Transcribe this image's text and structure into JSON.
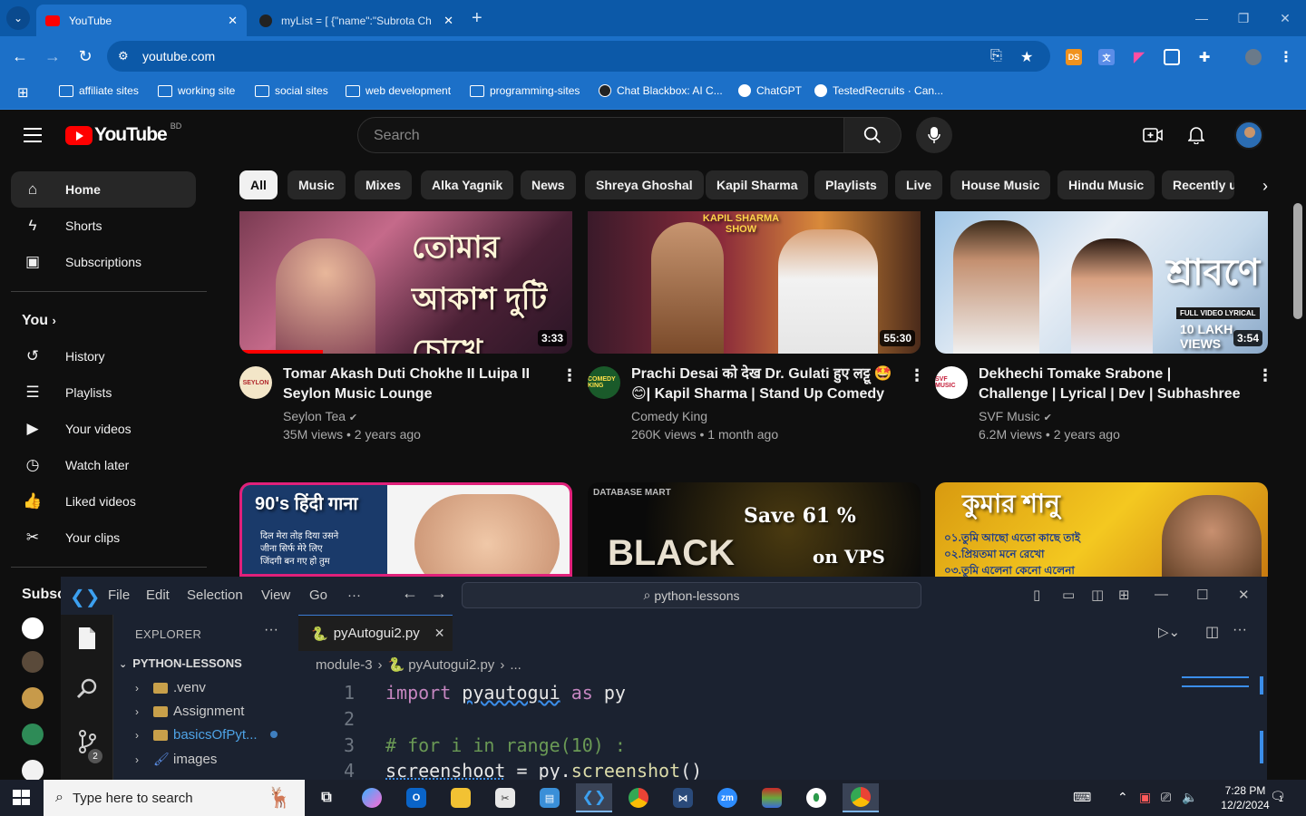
{
  "browser": {
    "tabs": [
      {
        "title": "YouTube",
        "active": true
      },
      {
        "title": "myList = [ {\"name\":\"Subrota Ch",
        "active": false
      }
    ],
    "url": "youtube.com",
    "bookmarks": [
      "affiliate sites",
      "working site",
      "social sites",
      "web development",
      "programming-sites",
      "Chat Blackbox: AI C...",
      "ChatGPT",
      "TestedRecruits · Can..."
    ],
    "ext_ds": "DS"
  },
  "youtube": {
    "logo_text": "YouTube",
    "country_code": "BD",
    "search_placeholder": "Search",
    "sidebar": {
      "main": [
        "Home",
        "Shorts",
        "Subscriptions"
      ],
      "you_heading": "You",
      "you_items": [
        "History",
        "Playlists",
        "Your videos",
        "Watch later",
        "Liked videos",
        "Your clips"
      ],
      "subscriptions_heading": "Subsc"
    },
    "chips": [
      "All",
      "Music",
      "Mixes",
      "Alka Yagnik",
      "News",
      "Shreya Ghoshal",
      "Kapil Sharma",
      "Playlists",
      "Live",
      "House Music",
      "Hindu Music",
      "Recently u"
    ],
    "videos": [
      {
        "title": "Tomar Akash Duti Chokhe II Luipa II Seylon Music Lounge",
        "channel": "Seylon Tea",
        "meta": "35M views • 2 years ago",
        "duration": "3:33",
        "thumb_text": "তোমার আকাশ দুটি চোখে",
        "avatar_text": "SEYLON",
        "progress": 0.25
      },
      {
        "title": "Prachi Desai को देख Dr. Gulati हुए लट्टू 🤩😊| Kapil Sharma | Stand Up Comedy |...",
        "channel": "Comedy King",
        "meta": "260K views • 1 month ago",
        "duration": "55:30",
        "thumb_text": "KAPIL SHARMA SHOW",
        "avatar_text": "COMEDY KING"
      },
      {
        "title": "Dekhechi Tomake Srabone | Challenge | Lyrical | Dev | Subhashree | Shaan, June...",
        "channel": "SVF Music",
        "meta": "6.2M views • 2 years ago",
        "duration": "3:54",
        "thumb_text": "শ্রাবণে",
        "thumb_badge": "FULL VIDEO LYRICAL",
        "thumb_views": "10 LAKH VIEWS",
        "avatar_text": "SVF MUSIC"
      }
    ],
    "row2_thumbs": [
      {
        "text": "90's हिंदी गाना",
        "lines": [
          "दिल मेरा तोड़ दिया उसने",
          "जीना सिर्फ मेरे लिए",
          "जिंदगी बन गए हो तुम"
        ]
      },
      {
        "text": "BLACK",
        "brand": "DATABASE MART",
        "offer": "Save 61 %",
        "offer_sub": "on VPS"
      },
      {
        "text": "কুমার শানু",
        "lines": [
          "০১.তুমি আছো এতো কাছে তাই",
          "০২.প্রিয়তমা মনে রেখো",
          "০৩.তুমি এলেনা কেনো এলেনা"
        ]
      }
    ]
  },
  "vscode": {
    "menu": [
      "File",
      "Edit",
      "Selection",
      "View",
      "Go",
      "···"
    ],
    "command_center": "python-lessons",
    "explorer_title": "EXPLORER",
    "root": "PYTHON-LESSONS",
    "tree": [
      ".venv",
      "Assignment",
      "basicsOfPyt...",
      "images"
    ],
    "tab": "pyAutogui2.py",
    "breadcrumb": [
      "module-3",
      "pyAutogui2.py",
      "..."
    ],
    "scm_badge": "2",
    "code": [
      {
        "n": "1",
        "text": "import pyautogui as py"
      },
      {
        "n": "2",
        "text": ""
      },
      {
        "n": "3",
        "text": "# for i in range(10) :"
      },
      {
        "n": "4",
        "text": "screenshoot = py.screenshot()"
      }
    ]
  },
  "taskbar": {
    "search_placeholder": "Type here to search",
    "time": "7:28 PM",
    "date": "12/2/2024",
    "notification_count": "1"
  }
}
